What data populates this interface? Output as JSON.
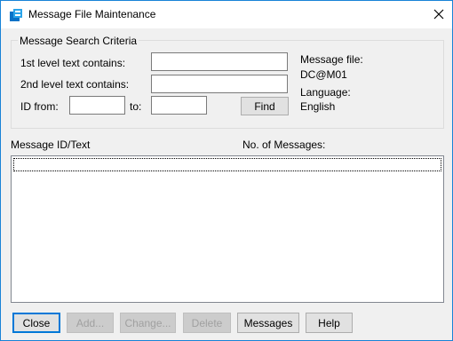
{
  "window": {
    "title": "Message File Maintenance",
    "icon": "app-window-icon",
    "close_icon": "close-icon"
  },
  "criteria": {
    "group_label": "Message Search Criteria",
    "first_level_label": "1st level text contains:",
    "first_level_value": "",
    "second_level_label": "2nd level text contains:",
    "second_level_value": "",
    "id_from_label": "ID from:",
    "id_from_value": "",
    "id_to_label": "to:",
    "id_to_value": "",
    "find_button_label": "Find"
  },
  "info": {
    "message_file_label": "Message file:",
    "message_file_value": "DC@M01",
    "language_label": "Language:",
    "language_value": "English"
  },
  "list": {
    "column_message_id_text": "Message ID/Text",
    "column_no_of_messages": "No. of Messages:",
    "no_of_messages_value": "",
    "items": []
  },
  "buttons": {
    "close": "Close",
    "add": "Add...",
    "change": "Change...",
    "delete": "Delete",
    "messages": "Messages",
    "help": "Help"
  },
  "colors": {
    "window_border": "#1883d7",
    "dialog_background": "#f0f0f0",
    "default_button_border": "#0078d7",
    "disabled_text": "#a0a0a0"
  }
}
